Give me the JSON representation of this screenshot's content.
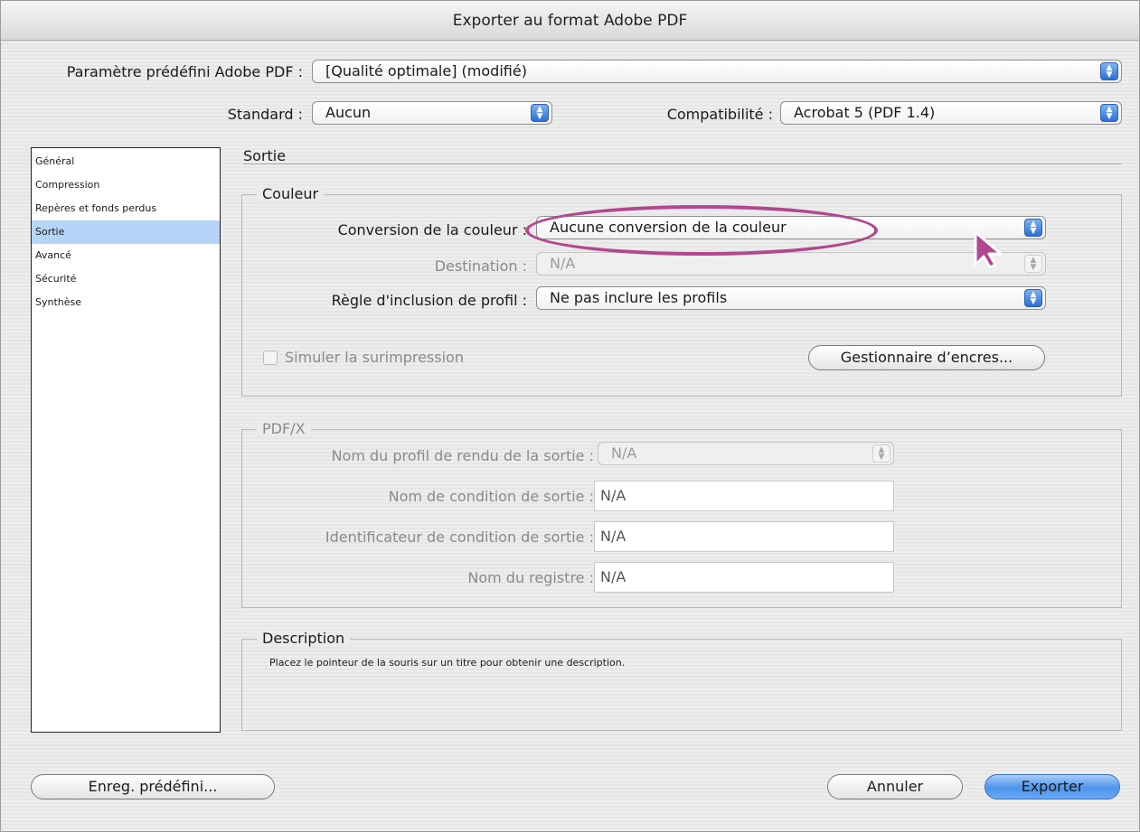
{
  "window": {
    "title": "Exporter au format Adobe PDF"
  },
  "preset": {
    "label": "Paramètre prédéfini Adobe PDF :",
    "value": "[Qualité optimale] (modifié)"
  },
  "standard": {
    "label": "Standard :",
    "value": "Aucun"
  },
  "compat": {
    "label": "Compatibilité :",
    "value": "Acrobat 5 (PDF 1.4)"
  },
  "sidebar": {
    "items": [
      {
        "label": "Général"
      },
      {
        "label": "Compression"
      },
      {
        "label": "Repères et fonds perdus"
      },
      {
        "label": "Sortie"
      },
      {
        "label": "Avancé"
      },
      {
        "label": "Sécurité"
      },
      {
        "label": "Synthèse"
      }
    ],
    "selected": "Sortie"
  },
  "section": {
    "title": "Sortie"
  },
  "couleur": {
    "group_label": "Couleur",
    "conversion_label": "Conversion de la couleur :",
    "conversion_value": "Aucune conversion de la couleur",
    "destination_label": "Destination :",
    "destination_value": "N/A",
    "profile_rule_label": "Règle d'inclusion de profil :",
    "profile_rule_value": "Ne pas inclure les profils",
    "simulate_label": "Simuler la surimpression",
    "ink_manager_label": "Gestionnaire d’encres..."
  },
  "pdfx": {
    "group_label": "PDF/X",
    "render_profile_label": "Nom du profil de rendu de la sortie :",
    "render_profile_value": "N/A",
    "condition_name_label": "Nom de condition de sortie :",
    "condition_name_value": "N/A",
    "condition_id_label": "Identificateur de condition de sortie :",
    "condition_id_value": "N/A",
    "registry_label": "Nom du registre :",
    "registry_value": "N/A"
  },
  "description": {
    "group_label": "Description",
    "text": "Placez le pointeur de la souris sur un titre pour obtenir une description."
  },
  "buttons": {
    "save_preset": "Enreg. prédéfini...",
    "cancel": "Annuler",
    "export": "Exporter"
  },
  "icons": {
    "popup_arrows": "⬍",
    "cursor": "arrow-pointer-icon"
  },
  "colors": {
    "highlight_ellipse": "#b2478f",
    "selection": "#b6d4f7",
    "accent": "#2b6fd3"
  }
}
